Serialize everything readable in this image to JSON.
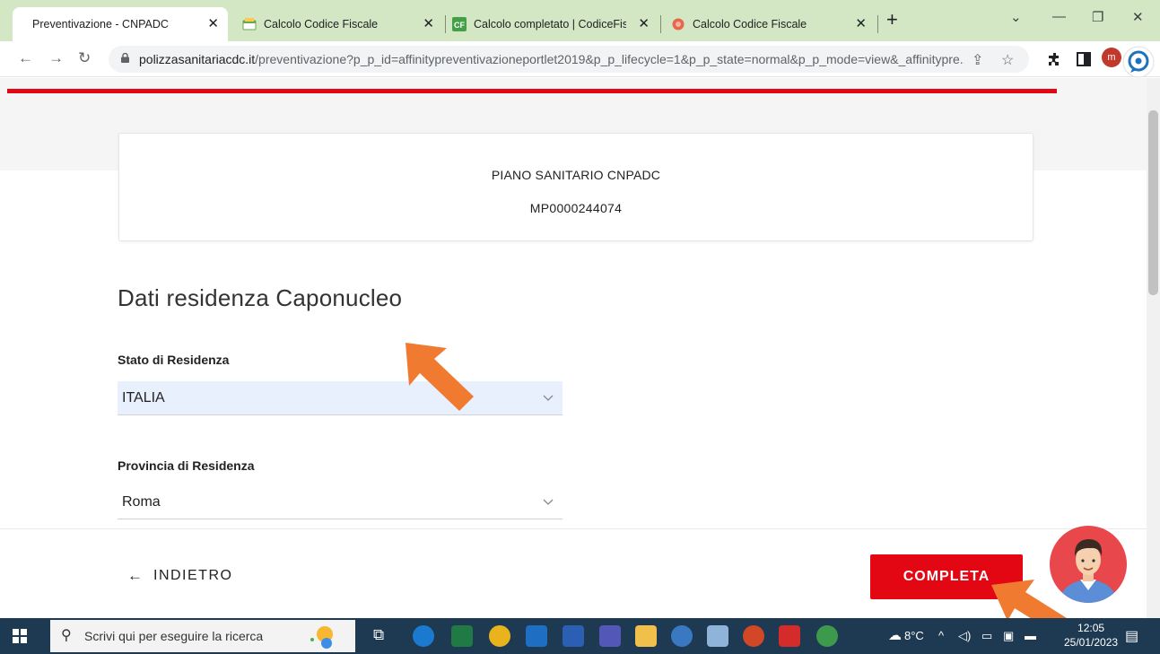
{
  "browser": {
    "tabs": [
      {
        "title": "Preventivazione - CNPADC",
        "icon": "blank-page-icon",
        "active": true
      },
      {
        "title": "Calcolo Codice Fiscale",
        "icon": "codice-fiscale-icon",
        "active": false
      },
      {
        "title": "Calcolo completato | CodiceFisca",
        "icon": "cf-logo-icon",
        "active": false
      },
      {
        "title": "Calcolo Codice Fiscale",
        "icon": "red-circle-icon",
        "active": false
      }
    ],
    "new_tab": "+",
    "url_host": "polizzasanitariacdc.it",
    "url_path": "/preventivazione?p_p_id=affinitypreventivazioneportlet2019&p_p_lifecycle=1&p_p_state=normal&p_p_mode=view&_affinitypre...",
    "profile_initial": "m"
  },
  "plan": {
    "name": "PIANO SANITARIO CNPADC",
    "code": "MP0000244074"
  },
  "section": {
    "title": "Dati residenza Caponucleo"
  },
  "form": {
    "stato_label": "Stato di Residenza",
    "stato_value": "ITALIA",
    "provincia_label": "Provincia di Residenza",
    "provincia_value": "Roma"
  },
  "footer": {
    "back_arrow": "←",
    "back_label": "INDIETRO",
    "complete_label": "COMPLETA"
  },
  "taskbar": {
    "search_placeholder": "Scrivi qui per eseguire la ricerca",
    "weather": "8°C",
    "time": "12:05",
    "date": "25/01/2023"
  },
  "colors": {
    "brand_red": "#e30613",
    "annotation_orange": "#f07a30",
    "tabstrip_green": "#d3e7c4",
    "taskbar": "#1e3a52"
  }
}
